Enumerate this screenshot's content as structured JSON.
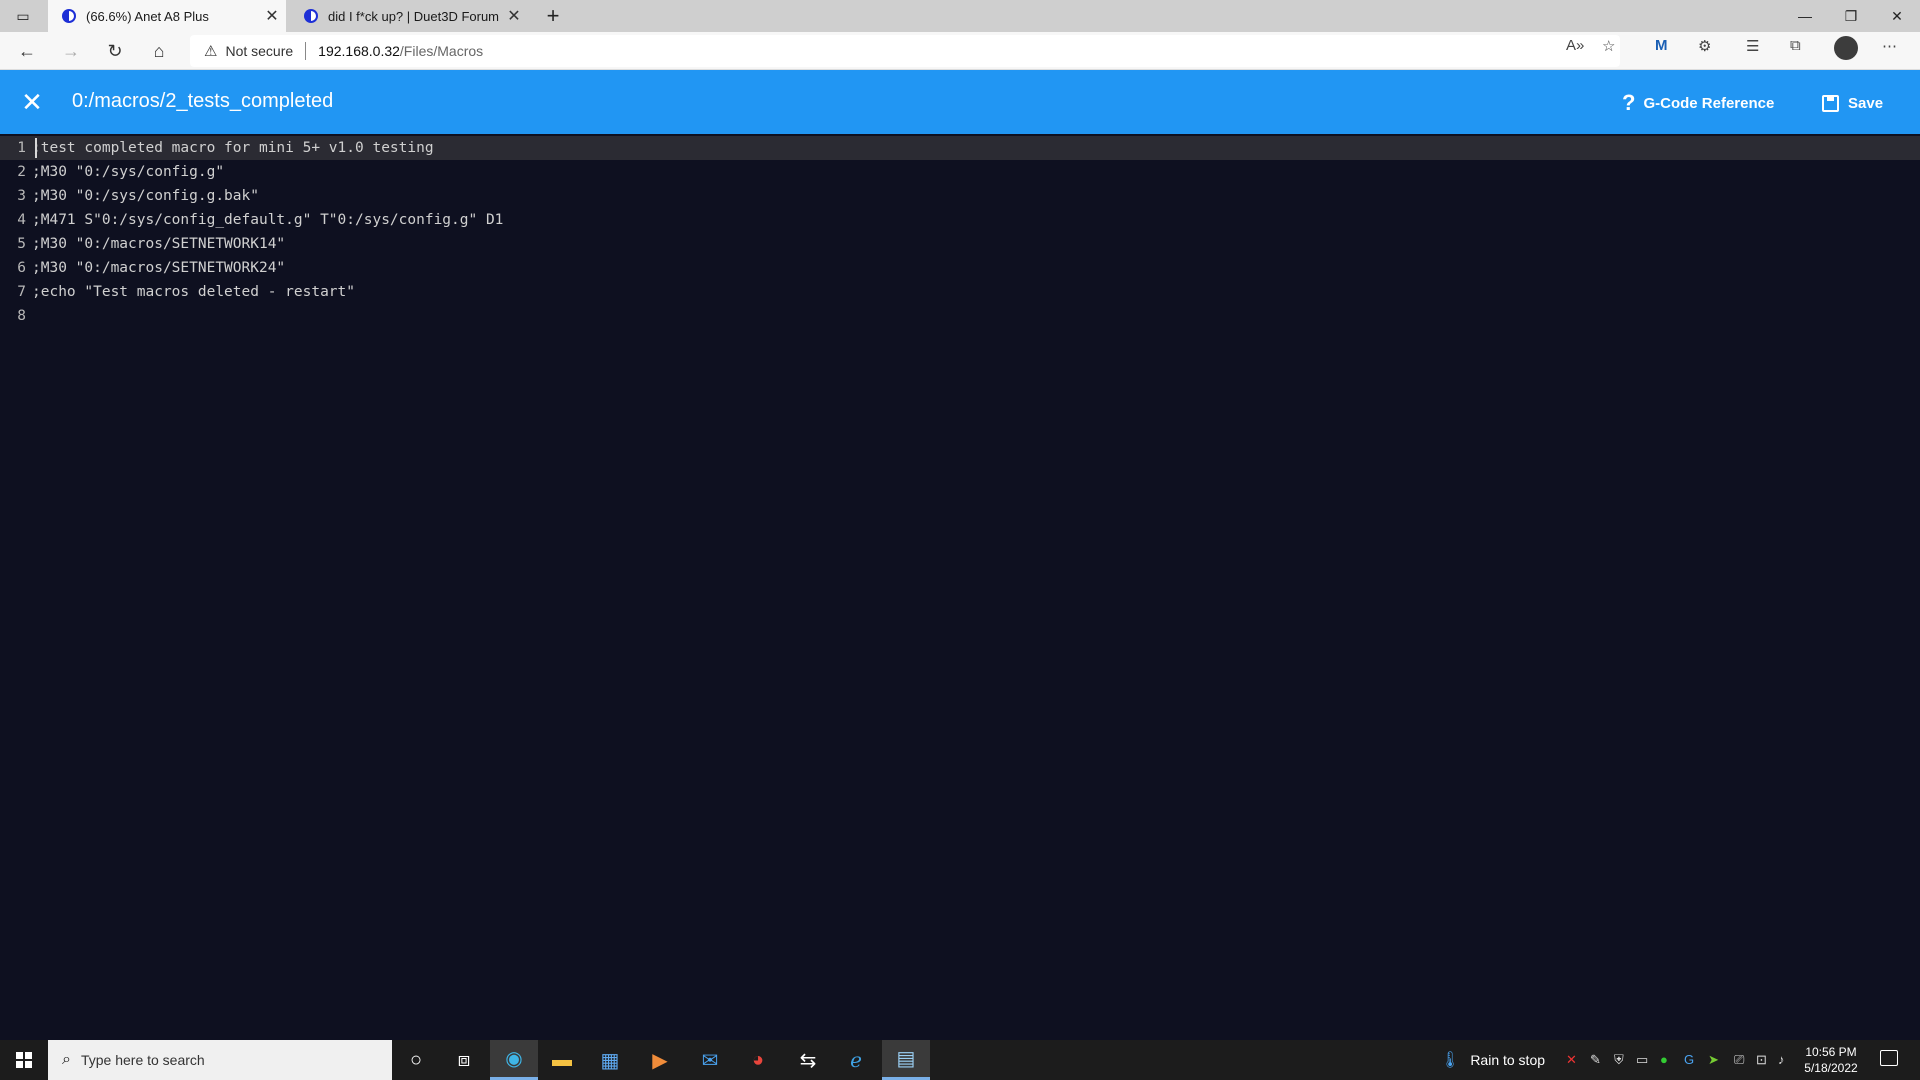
{
  "browser": {
    "tabs": [
      {
        "label": "(66.6%) Anet A8 Plus",
        "active": true
      },
      {
        "label": "did I f*ck up? | Duet3D Forum",
        "active": false
      }
    ],
    "new_tab_label": "+",
    "address": {
      "security": "Not secure",
      "host": "192.168.0.32",
      "path": "/Files/Macros"
    }
  },
  "app": {
    "title": "0:/macros/2_tests_completed",
    "close_glyph": "✕",
    "gcode_reference_label": "G-Code Reference",
    "save_label": "Save"
  },
  "editor": {
    "current_line": 1,
    "lines": [
      {
        "num": "1",
        "text": ";test completed macro for mini 5+ v1.0 testing"
      },
      {
        "num": "2",
        "text": ";M30 \"0:/sys/config.g\""
      },
      {
        "num": "3",
        "text": ";M30 \"0:/sys/config.g.bak\""
      },
      {
        "num": "4",
        "text": ";M471 S\"0:/sys/config_default.g\" T\"0:/sys/config.g\" D1"
      },
      {
        "num": "5",
        "text": ";M30 \"0:/macros/SETNETWORK14\""
      },
      {
        "num": "6",
        "text": ";M30 \"0:/macros/SETNETWORK24\""
      },
      {
        "num": "7",
        "text": ";echo \"Test macros deleted - restart\""
      },
      {
        "num": "8",
        "text": ""
      }
    ]
  },
  "taskbar": {
    "search_placeholder": "Type here to search",
    "weather": "Rain to stop",
    "time": "10:56 PM",
    "date": "5/18/2022",
    "apps": [
      "cortana-icon",
      "task-view-icon",
      "edge-icon",
      "file-explorer-icon",
      "store-icon",
      "media-player-icon",
      "mail-icon",
      "chrome-icon",
      "settings-tool-icon",
      "internet-explorer-icon",
      "notepad-icon"
    ]
  },
  "colors": {
    "appbar": "#2196f3",
    "editor_bg": "#0e1020",
    "current_line_bg": "#2b2b33"
  }
}
